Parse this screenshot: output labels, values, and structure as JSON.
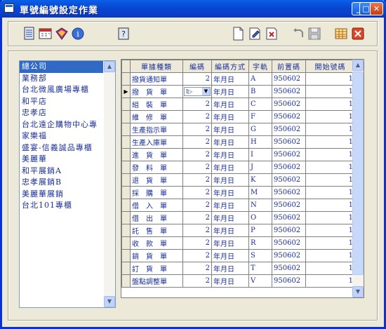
{
  "window": {
    "title": "單號編號設定作業"
  },
  "titlebar_buttons": {
    "min": "_",
    "max": "□",
    "close": "✕"
  },
  "toolbar": {
    "left_tools": [
      "list-icon",
      "calendar-icon",
      "book-icon",
      "info-icon"
    ],
    "help_tool": "help-icon",
    "right_tools": [
      "new-document-icon",
      "edit-document-icon",
      "delete-document-icon",
      "undo-icon",
      "save-icon",
      "grid-icon",
      "exit-icon"
    ]
  },
  "stores": {
    "items": [
      "總公司",
      "業務部",
      "台北微風廣場專櫃",
      "和平店",
      "忠孝店",
      "台北遠企購物中心專",
      "家樂福",
      "盛宴-信義誠品專櫃",
      "美麗華",
      "和平展銷A",
      "忠孝展銷B",
      "美麗華展銷",
      "台北101專櫃"
    ],
    "selected_index": 0
  },
  "grid": {
    "columns": [
      "單據種類",
      "編碼",
      "編碼方式",
      "字軌",
      "前置碼",
      "開始號碼"
    ],
    "current_row": 1,
    "current_row_marker": "▶",
    "edit_value": "I▷",
    "rows": [
      {
        "doc": "撥貨通知單",
        "code": "2",
        "mode": "年月日",
        "track": "A",
        "prefix": "950602",
        "start": "1"
      },
      {
        "doc": "撥　貨　單",
        "code": "2",
        "mode": "年月日",
        "track": "B",
        "prefix": "950602",
        "start": "1"
      },
      {
        "doc": "組　裝　單",
        "code": "2",
        "mode": "年月日",
        "track": "C",
        "prefix": "950602",
        "start": "1"
      },
      {
        "doc": "維　修　單",
        "code": "2",
        "mode": "年月日",
        "track": "F",
        "prefix": "950602",
        "start": "1"
      },
      {
        "doc": "生產指示單",
        "code": "2",
        "mode": "年月日",
        "track": "G",
        "prefix": "950602",
        "start": "1"
      },
      {
        "doc": "生產入庫單",
        "code": "2",
        "mode": "年月日",
        "track": "H",
        "prefix": "950602",
        "start": "1"
      },
      {
        "doc": "進　貨　單",
        "code": "2",
        "mode": "年月日",
        "track": "I",
        "prefix": "950602",
        "start": "1"
      },
      {
        "doc": "發　料　單",
        "code": "2",
        "mode": "年月日",
        "track": "J",
        "prefix": "950602",
        "start": "1"
      },
      {
        "doc": "退　貨　單",
        "code": "2",
        "mode": "年月日",
        "track": "K",
        "prefix": "950602",
        "start": "1"
      },
      {
        "doc": "採　購　單",
        "code": "2",
        "mode": "年月日",
        "track": "M",
        "prefix": "950602",
        "start": "1"
      },
      {
        "doc": "借　入　單",
        "code": "2",
        "mode": "年月日",
        "track": "N",
        "prefix": "950602",
        "start": "1"
      },
      {
        "doc": "借　出　單",
        "code": "2",
        "mode": "年月日",
        "track": "O",
        "prefix": "950602",
        "start": "1"
      },
      {
        "doc": "託　售　單",
        "code": "2",
        "mode": "年月日",
        "track": "P",
        "prefix": "950602",
        "start": "1"
      },
      {
        "doc": "收　款　單",
        "code": "2",
        "mode": "年月日",
        "track": "R",
        "prefix": "950602",
        "start": "1"
      },
      {
        "doc": "銷　貨　單",
        "code": "2",
        "mode": "年月日",
        "track": "S",
        "prefix": "950602",
        "start": "1"
      },
      {
        "doc": "訂　貨　單",
        "code": "2",
        "mode": "年月日",
        "track": "T",
        "prefix": "950602",
        "start": "1"
      },
      {
        "doc": "盤點調整單",
        "code": "2",
        "mode": "年月日",
        "track": "V",
        "prefix": "950602",
        "start": "1"
      }
    ]
  },
  "scroll": {
    "up": "▲",
    "down": "▼"
  }
}
